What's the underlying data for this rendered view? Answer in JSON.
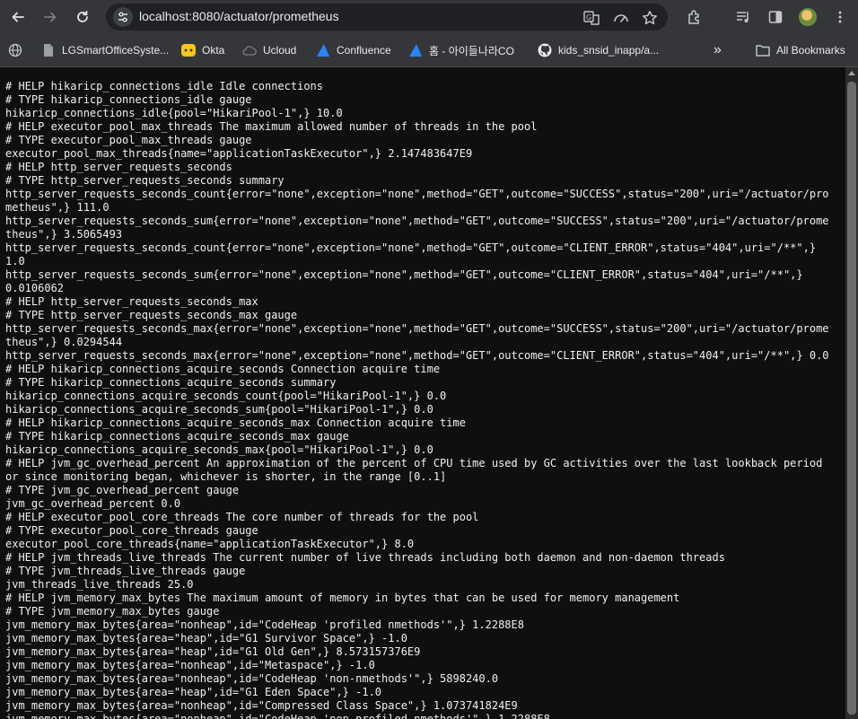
{
  "browser": {
    "url": "localhost:8080/actuator/prometheus",
    "toolbar_icons": [
      "back-arrow-icon",
      "forward-arrow-icon",
      "reload-icon",
      "site-info-icon",
      "translate-icon",
      "performance-icon",
      "bookmark-star-icon",
      "extensions-icon",
      "media-queue-icon",
      "side-panel-icon",
      "profile-avatar",
      "kebab-menu-icon"
    ]
  },
  "bookmarks": {
    "items": [
      {
        "label": "LGSmartOfficeSyste...",
        "icon": "page-icon"
      },
      {
        "label": "Okta",
        "icon": "okta-icon"
      },
      {
        "label": "Ucloud",
        "icon": "cloud-icon"
      },
      {
        "label": "Confluence",
        "icon": "atlassian-icon"
      },
      {
        "label": "홈 - 아이들나라CO",
        "icon": "atlassian-icon"
      },
      {
        "label": "kids_snsid_inapp/a...",
        "icon": "github-icon"
      }
    ],
    "more": "»",
    "all_bookmarks": "All Bookmarks"
  },
  "content": {
    "text": "# HELP hikaricp_connections_idle Idle connections\n# TYPE hikaricp_connections_idle gauge\nhikaricp_connections_idle{pool=\"HikariPool-1\",} 10.0\n# HELP executor_pool_max_threads The maximum allowed number of threads in the pool\n# TYPE executor_pool_max_threads gauge\nexecutor_pool_max_threads{name=\"applicationTaskExecutor\",} 2.147483647E9\n# HELP http_server_requests_seconds\n# TYPE http_server_requests_seconds summary\nhttp_server_requests_seconds_count{error=\"none\",exception=\"none\",method=\"GET\",outcome=\"SUCCESS\",status=\"200\",uri=\"/actuator/prometheus\",} 111.0\nhttp_server_requests_seconds_sum{error=\"none\",exception=\"none\",method=\"GET\",outcome=\"SUCCESS\",status=\"200\",uri=\"/actuator/prometheus\",} 3.5065493\nhttp_server_requests_seconds_count{error=\"none\",exception=\"none\",method=\"GET\",outcome=\"CLIENT_ERROR\",status=\"404\",uri=\"/**\",} 1.0\nhttp_server_requests_seconds_sum{error=\"none\",exception=\"none\",method=\"GET\",outcome=\"CLIENT_ERROR\",status=\"404\",uri=\"/**\",}\n0.0106062\n# HELP http_server_requests_seconds_max\n# TYPE http_server_requests_seconds_max gauge\nhttp_server_requests_seconds_max{error=\"none\",exception=\"none\",method=\"GET\",outcome=\"SUCCESS\",status=\"200\",uri=\"/actuator/prometheus\",} 0.0294544\nhttp_server_requests_seconds_max{error=\"none\",exception=\"none\",method=\"GET\",outcome=\"CLIENT_ERROR\",status=\"404\",uri=\"/**\",} 0.0\n# HELP hikaricp_connections_acquire_seconds Connection acquire time\n# TYPE hikaricp_connections_acquire_seconds summary\nhikaricp_connections_acquire_seconds_count{pool=\"HikariPool-1\",} 0.0\nhikaricp_connections_acquire_seconds_sum{pool=\"HikariPool-1\",} 0.0\n# HELP hikaricp_connections_acquire_seconds_max Connection acquire time\n# TYPE hikaricp_connections_acquire_seconds_max gauge\nhikaricp_connections_acquire_seconds_max{pool=\"HikariPool-1\",} 0.0\n# HELP jvm_gc_overhead_percent An approximation of the percent of CPU time used by GC activities over the last lookback period or since monitoring began, whichever is shorter, in the range [0..1]\n# TYPE jvm_gc_overhead_percent gauge\njvm_gc_overhead_percent 0.0\n# HELP executor_pool_core_threads The core number of threads for the pool\n# TYPE executor_pool_core_threads gauge\nexecutor_pool_core_threads{name=\"applicationTaskExecutor\",} 8.0\n# HELP jvm_threads_live_threads The current number of live threads including both daemon and non-daemon threads\n# TYPE jvm_threads_live_threads gauge\njvm_threads_live_threads 25.0\n# HELP jvm_memory_max_bytes The maximum amount of memory in bytes that can be used for memory management\n# TYPE jvm_memory_max_bytes gauge\njvm_memory_max_bytes{area=\"nonheap\",id=\"CodeHeap 'profiled nmethods'\",} 1.2288E8\njvm_memory_max_bytes{area=\"heap\",id=\"G1 Survivor Space\",} -1.0\njvm_memory_max_bytes{area=\"heap\",id=\"G1 Old Gen\",} 8.573157376E9\njvm_memory_max_bytes{area=\"nonheap\",id=\"Metaspace\",} -1.0\njvm_memory_max_bytes{area=\"nonheap\",id=\"CodeHeap 'non-nmethods'\",} 5898240.0\njvm_memory_max_bytes{area=\"heap\",id=\"G1 Eden Space\",} -1.0\njvm_memory_max_bytes{area=\"nonheap\",id=\"Compressed Class Space\",} 1.073741824E9\njvm_memory_max_bytes{area=\"nonheap\",id=\"CodeHeap 'non-profiled nmethods'\",} 1.2288E8\n# HELP application_started_time_seconds Time taken (ms) to start the application"
  }
}
